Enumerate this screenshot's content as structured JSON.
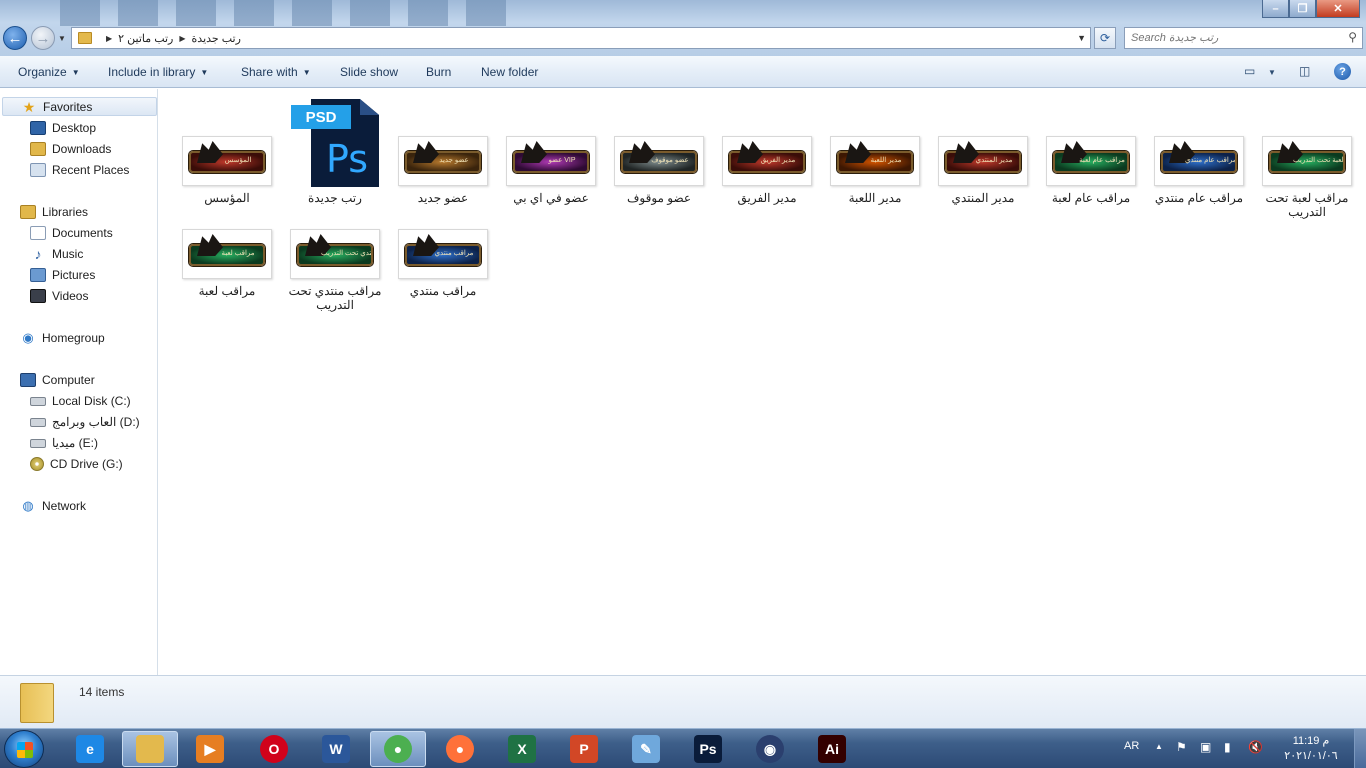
{
  "window": {
    "controls": {
      "minimize": "–",
      "maximize": "❐",
      "close": "✕"
    }
  },
  "address_bar": {
    "breadcrumbs": [
      "رتب ماتين ٢",
      "رتب جديدة"
    ],
    "search_placeholder": "Search رتب جديدة"
  },
  "toolbar": {
    "organize": "Organize",
    "include_in_library": "Include in library",
    "share_with": "Share with",
    "slide_show": "Slide show",
    "burn": "Burn",
    "new_folder": "New folder",
    "help": "?"
  },
  "sidebar": {
    "favorites": {
      "label": "Favorites",
      "items": [
        "Desktop",
        "Downloads",
        "Recent Places"
      ]
    },
    "libraries": {
      "label": "Libraries",
      "items": [
        "Documents",
        "Music",
        "Pictures",
        "Videos"
      ]
    },
    "homegroup": "Homegroup",
    "computer": {
      "label": "Computer",
      "items": [
        "Local Disk (C:)",
        "العاب وبرامج (D:)",
        "ميديا (E:)",
        "CD Drive (G:)"
      ]
    },
    "network": "Network"
  },
  "files": [
    {
      "name": "المؤسس",
      "type": "png",
      "banner_text": "المؤسس",
      "colors": [
        "#c0392b",
        "#3a0d08"
      ]
    },
    {
      "name": "رتب جديدة",
      "type": "psd",
      "psd_tag": "PSD",
      "ps_text": "Ps"
    },
    {
      "name": "عضو جديد",
      "type": "png",
      "banner_text": "عضو جديد",
      "colors": [
        "#b87a2e",
        "#3a240c"
      ]
    },
    {
      "name": "عضو في اي بي",
      "type": "png",
      "banner_text": "عضو VIP",
      "colors": [
        "#b03ab5",
        "#2e0a33"
      ]
    },
    {
      "name": "عضو موقوف",
      "type": "png",
      "banner_text": "عضو موقوف",
      "colors": [
        "#7f8c8d",
        "#1f2424"
      ]
    },
    {
      "name": "مدير الفريق",
      "type": "png",
      "banner_text": "مدير الفريق",
      "colors": [
        "#c0392b",
        "#3a0d08"
      ]
    },
    {
      "name": "مدير اللعبة",
      "type": "png",
      "banner_text": "مدير اللعبة",
      "colors": [
        "#d35400",
        "#3d1702"
      ]
    },
    {
      "name": "مدير المنتدي",
      "type": "png",
      "banner_text": "مدير المنتدي",
      "colors": [
        "#c0392b",
        "#3a0d08"
      ]
    },
    {
      "name": "مراقب عام لعبة",
      "type": "png",
      "banner_text": "مراقب عام لعبة",
      "colors": [
        "#27ae60",
        "#0b3a1f"
      ]
    },
    {
      "name": "مراقب عام منتدي",
      "type": "png",
      "banner_text": "مراقب عام منتدي",
      "colors": [
        "#2e6fc9",
        "#0c2148"
      ]
    },
    {
      "name": "مراقب لعبة تحت التدريب",
      "type": "png",
      "banner_text": "مراقب لعبة تحت التدريب",
      "colors": [
        "#27ae60",
        "#0b3a1f"
      ]
    },
    {
      "name": "مراقب لعبة",
      "type": "png",
      "banner_text": "مراقب لعبة",
      "colors": [
        "#27ae60",
        "#0b3a1f"
      ]
    },
    {
      "name": "مراقب منتدي تحت التدريب",
      "type": "png",
      "banner_text": "مراقب منتدي تحت التدريب",
      "colors": [
        "#27ae60",
        "#0b3a1f"
      ]
    },
    {
      "name": "مراقب منتدي",
      "type": "png",
      "banner_text": "مراقب منتدي",
      "colors": [
        "#2e6fc9",
        "#0c2148"
      ]
    }
  ],
  "details": {
    "item_count": "14 items"
  },
  "taskbar": {
    "apps": [
      {
        "name": "internet-explorer",
        "glyph": "e",
        "color": "#1e88e5"
      },
      {
        "name": "windows-explorer",
        "glyph": "",
        "color": "#e3b94d",
        "active": true
      },
      {
        "name": "media-player",
        "glyph": "▶",
        "color": "#e67e22"
      },
      {
        "name": "opera",
        "glyph": "O",
        "color": "#d0021b"
      },
      {
        "name": "word",
        "glyph": "W",
        "color": "#2b579a"
      },
      {
        "name": "chrome",
        "glyph": "●",
        "color": "#4caf50",
        "active": true
      },
      {
        "name": "firefox",
        "glyph": "●",
        "color": "#ff7139"
      },
      {
        "name": "excel",
        "glyph": "X",
        "color": "#1f7244"
      },
      {
        "name": "powerpoint",
        "glyph": "P",
        "color": "#d24726"
      },
      {
        "name": "paint",
        "glyph": "✎",
        "color": "#6fa8dc"
      },
      {
        "name": "photoshop",
        "glyph": "Ps",
        "color": "#0a1c3a"
      },
      {
        "name": "eye-app",
        "glyph": "◉",
        "color": "#2b3f6e"
      },
      {
        "name": "illustrator",
        "glyph": "Ai",
        "color": "#330000"
      }
    ],
    "language": "AR",
    "time": "11:19 م",
    "date": "٢٠٢١/٠١/٠٦"
  }
}
